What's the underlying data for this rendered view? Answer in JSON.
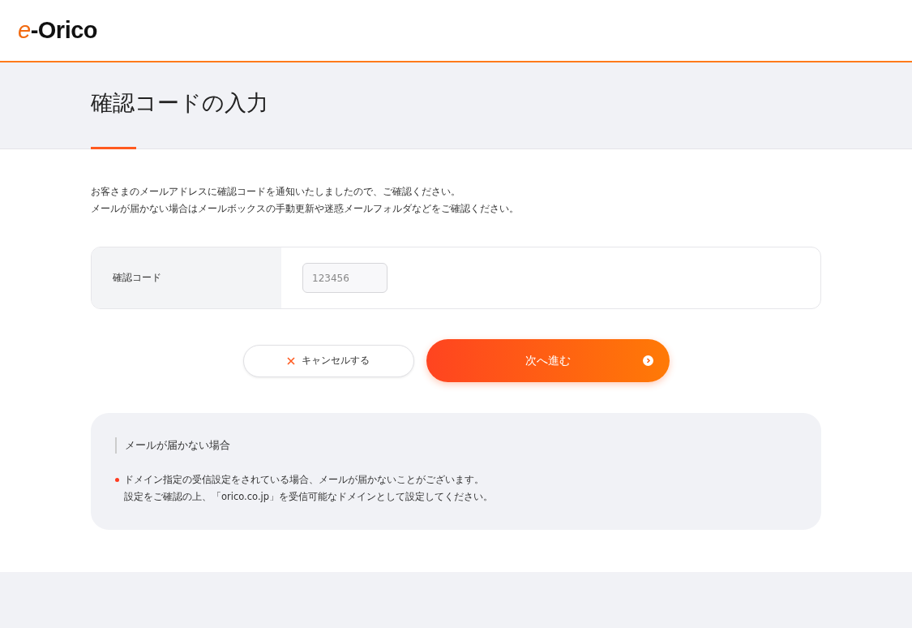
{
  "logo": {
    "accent": "e",
    "text": "-Orico"
  },
  "page_title": "確認コードの入力",
  "intro": [
    "お客さまのメールアドレスに確認コードを通知いたしましたので、ご確認ください。",
    "メールが届かない場合はメールボックスの手動更新や迷惑メールフォルダなどをご確認ください。"
  ],
  "form": {
    "label": "確認コード",
    "placeholder": "123456"
  },
  "buttons": [
    {
      "kind": "cancel",
      "label": "キャンセルする"
    },
    {
      "kind": "next",
      "label": "次へ進む"
    }
  ],
  "notice": {
    "title": "メールが届かない場合",
    "items": [
      {
        "lines": [
          "ドメイン指定の受信設定をされている場合、メールが届かないことがございます。",
          "設定をご確認の上、「orico.co.jp」を受信可能なドメインとして設定してください。"
        ]
      }
    ]
  }
}
